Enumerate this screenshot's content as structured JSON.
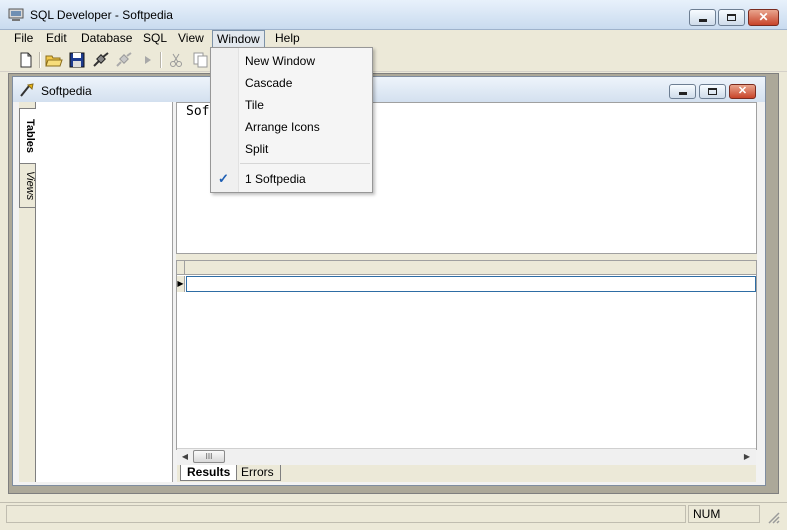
{
  "window": {
    "title": "SQL Developer - Softpedia",
    "minimize_icon": "minimize-icon",
    "maximize_icon": "maximize-icon",
    "close_icon": "close-icon",
    "close_glyph": "✕"
  },
  "menubar": {
    "items": [
      "File",
      "Edit",
      "Database",
      "SQL",
      "View",
      "Window",
      "Help"
    ],
    "active": "Window"
  },
  "window_menu": {
    "items": [
      "New Window",
      "Cascade",
      "Tile",
      "Arrange Icons",
      "Split"
    ],
    "window_list": [
      "1 Softpedia"
    ],
    "checked": "1 Softpedia",
    "check_glyph": "✓"
  },
  "toolbar": {
    "icons": [
      "new-file-icon",
      "open-folder-icon",
      "save-icon",
      "connect-icon",
      "disconnect-icon",
      "run-icon",
      "cut-icon",
      "copy-icon"
    ]
  },
  "child_window": {
    "title": "Softpedia",
    "close_glyph": "✕"
  },
  "side_tabs": [
    "Tables",
    "Views"
  ],
  "editor": {
    "text": "Sof"
  },
  "grid": {
    "row_indicator": "▶"
  },
  "hscroll": {
    "left": "◀",
    "right": "▶",
    "thumb": "III"
  },
  "result_tabs": [
    "Results",
    "Errors"
  ],
  "statusbar": {
    "num": "NUM"
  },
  "colors": {
    "accent": "#2e6da4",
    "check": "#1e5fb4",
    "close_button": "#c8442a"
  }
}
